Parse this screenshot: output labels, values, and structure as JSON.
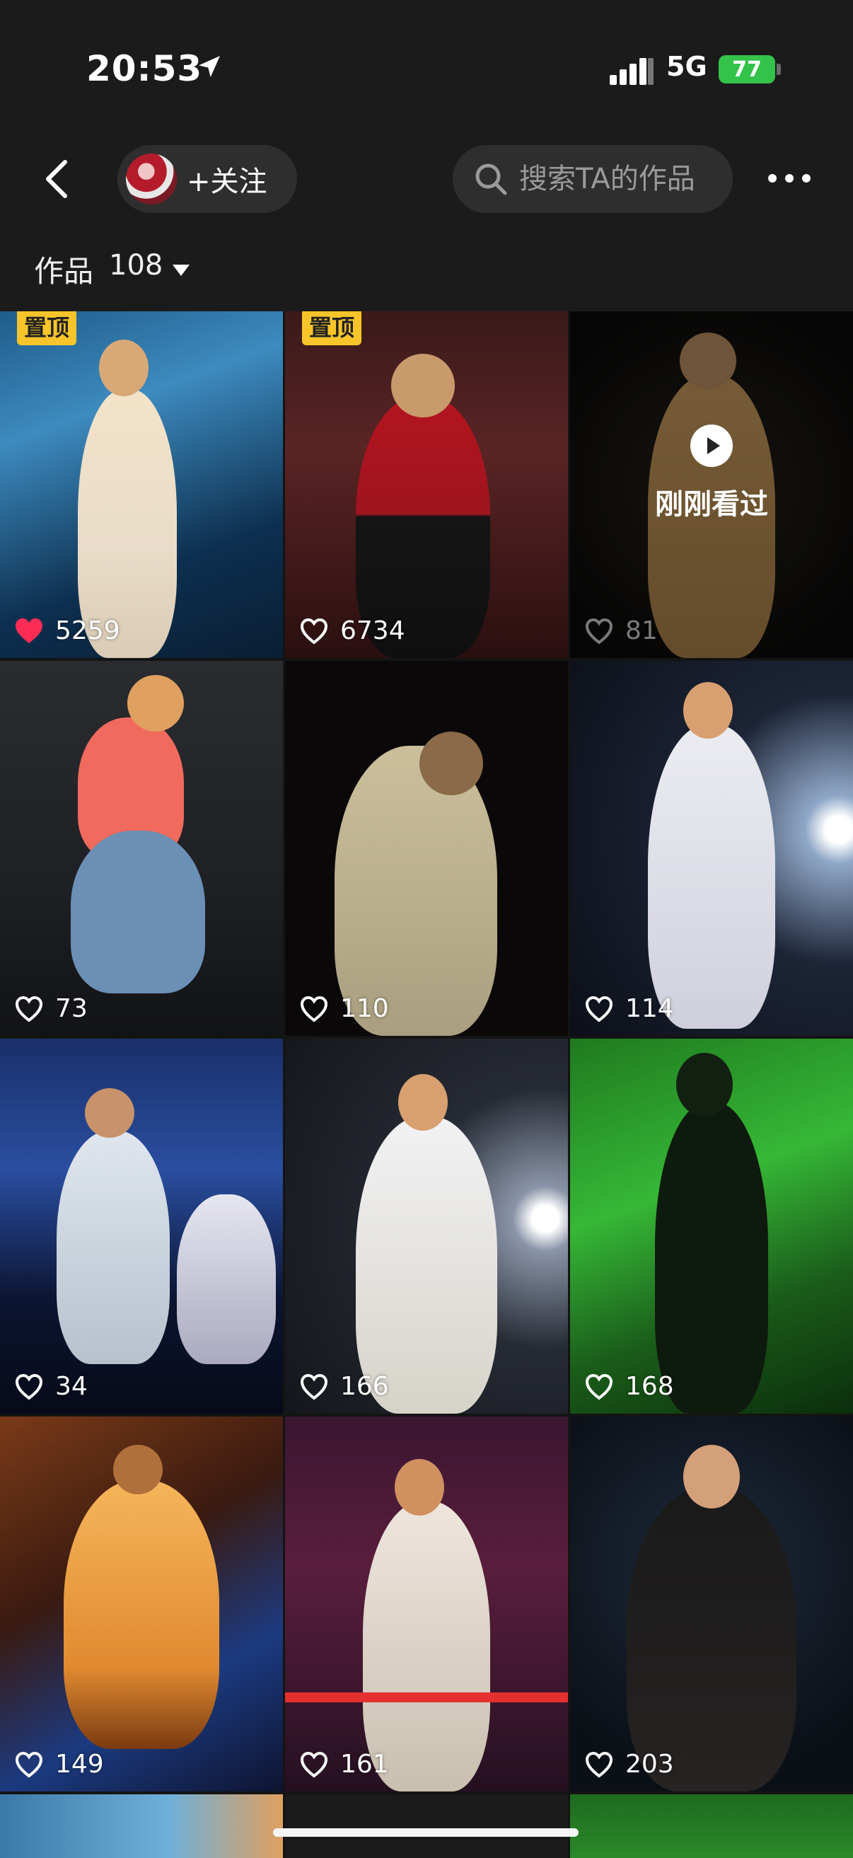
{
  "status_bar": {
    "time": "20:53",
    "network": "5G",
    "battery": "77",
    "icons": [
      "location-arrow-icon",
      "signal-icon",
      "battery-icon"
    ]
  },
  "header": {
    "back_icon": "chevron-left-icon",
    "follow_label": "+关注",
    "search_placeholder": "搜索TA的作品",
    "more_icon": "more-dots-icon"
  },
  "works": {
    "label": "作品",
    "count": "108",
    "dropdown_icon": "caret-down-icon"
  },
  "colors": {
    "background": "#141414",
    "header": "#1b1b1b",
    "pill": "#2e2e2e",
    "liked_heart": "#fe2c55",
    "pinned_badge": "#f7c52a",
    "battery": "#33c24a"
  },
  "grid": {
    "tiles": [
      {
        "likes": "5259",
        "pinned": "置顶",
        "liked": true
      },
      {
        "likes": "6734",
        "pinned": "置顶",
        "liked": false
      },
      {
        "likes": "81",
        "seen_label": "刚刚看过",
        "liked": false
      },
      {
        "likes": "73",
        "liked": false
      },
      {
        "likes": "110",
        "liked": false
      },
      {
        "likes": "114",
        "liked": false
      },
      {
        "likes": "34",
        "liked": false
      },
      {
        "likes": "166",
        "liked": false
      },
      {
        "likes": "168",
        "liked": false
      },
      {
        "likes": "149",
        "liked": false
      },
      {
        "likes": "161",
        "liked": false
      },
      {
        "likes": "203",
        "liked": false
      }
    ]
  }
}
